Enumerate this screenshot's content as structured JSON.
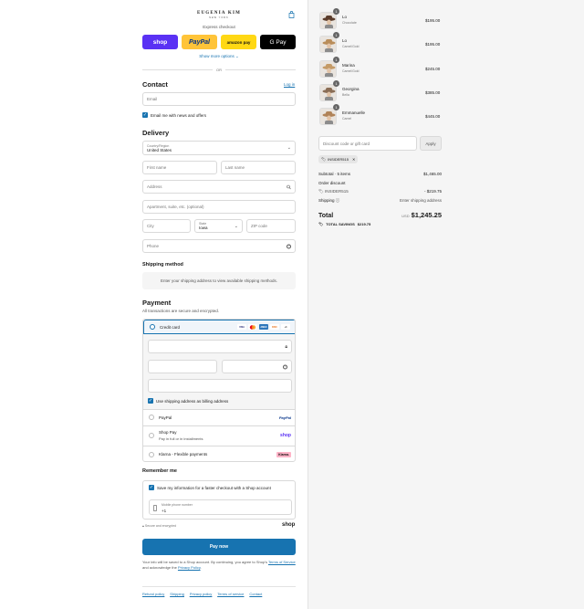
{
  "brand": {
    "name": "EUGENIA KIM",
    "sub": "NEW YORK"
  },
  "express": {
    "label": "Express checkout",
    "wallets": [
      "shop",
      "PayPal",
      "amazon pay",
      "G Pay"
    ],
    "show_more": "Show more options ⌄",
    "or": "OR"
  },
  "contact": {
    "title": "Contact",
    "login": "Log in",
    "email_placeholder": "Email",
    "news_label": "Email me with news and offers"
  },
  "delivery": {
    "title": "Delivery",
    "country_label": "Country/Region",
    "country_value": "United States",
    "first_name": "First name",
    "last_name": "Last name",
    "address": "Address",
    "apartment": "Apartment, suite, etc. (optional)",
    "city": "City",
    "state_label": "State",
    "state_value": "Iowa",
    "zip": "ZIP code",
    "phone": "Phone"
  },
  "shipping": {
    "title": "Shipping method",
    "note": "Enter your shipping address to view available shipping methods."
  },
  "payment": {
    "title": "Payment",
    "subtitle": "All transactions are secure and encrypted.",
    "credit_card": "Credit card",
    "card_logos": [
      "VISA",
      "MC",
      "AMEX",
      "DISC",
      "+4"
    ],
    "billing_same": "Use shipping address as billing address",
    "paypal": "PayPal",
    "paypal_logo": "PayPal",
    "shop_pay": "Shop Pay",
    "shop_pay_sub": "Pay in full or in installments",
    "shop_logo": "shop",
    "klarna": "Klarna - Flexible payments",
    "klarna_logo": "Klarna."
  },
  "remember": {
    "title": "Remember me",
    "save_label": "Save my information for a faster checkout with a Shop account",
    "mobile_label": "Mobile phone number",
    "mobile_value": "+1",
    "secure": "Secure and encrypted",
    "shop_logo": "shop"
  },
  "pay_now": "Pay now",
  "legal": {
    "text1": "Your info will be saved to a Shop account. By continuing, you agree to Shop's",
    "tos": "Terms of Service",
    "text2": "and acknowledge the",
    "privacy": "Privacy Policy",
    "end": "."
  },
  "footer": [
    "Refund policy",
    "Shipping",
    "Privacy policy",
    "Terms of service",
    "Contact"
  ],
  "cart": {
    "items": [
      {
        "name": "Lo",
        "variant": "Chocolate",
        "price": "$195.00",
        "qty": "1"
      },
      {
        "name": "Lo",
        "variant": "Camel/Gold",
        "price": "$195.00",
        "qty": "1"
      },
      {
        "name": "Marina",
        "variant": "Camel/Gold",
        "price": "$245.00",
        "qty": "1"
      },
      {
        "name": "Georgina",
        "variant": "Bella",
        "price": "$385.00",
        "qty": "1"
      },
      {
        "name": "Emmanuelle",
        "variant": "Camel",
        "price": "$445.00",
        "qty": "1"
      }
    ],
    "discount_placeholder": "Discount code or gift card",
    "apply": "Apply",
    "code": "INSIDER515",
    "subtotal_label": "Subtotal · 5 items",
    "subtotal_value": "$1,465.00",
    "order_discount": "Order discount",
    "discount_code": "INSIDER515",
    "discount_value": "- $219.75",
    "shipping_label": "Shipping",
    "shipping_value": "Enter shipping address",
    "total_label": "Total",
    "currency": "USD",
    "total_value": "$1,245.25",
    "savings_label": "TOTAL SAVINGS",
    "savings_value": "$219.75"
  },
  "colors": {
    "accent": "#1773b0",
    "shop": "#5a31f4",
    "paypal": "#ffc439",
    "amazon": "#ffd814"
  }
}
